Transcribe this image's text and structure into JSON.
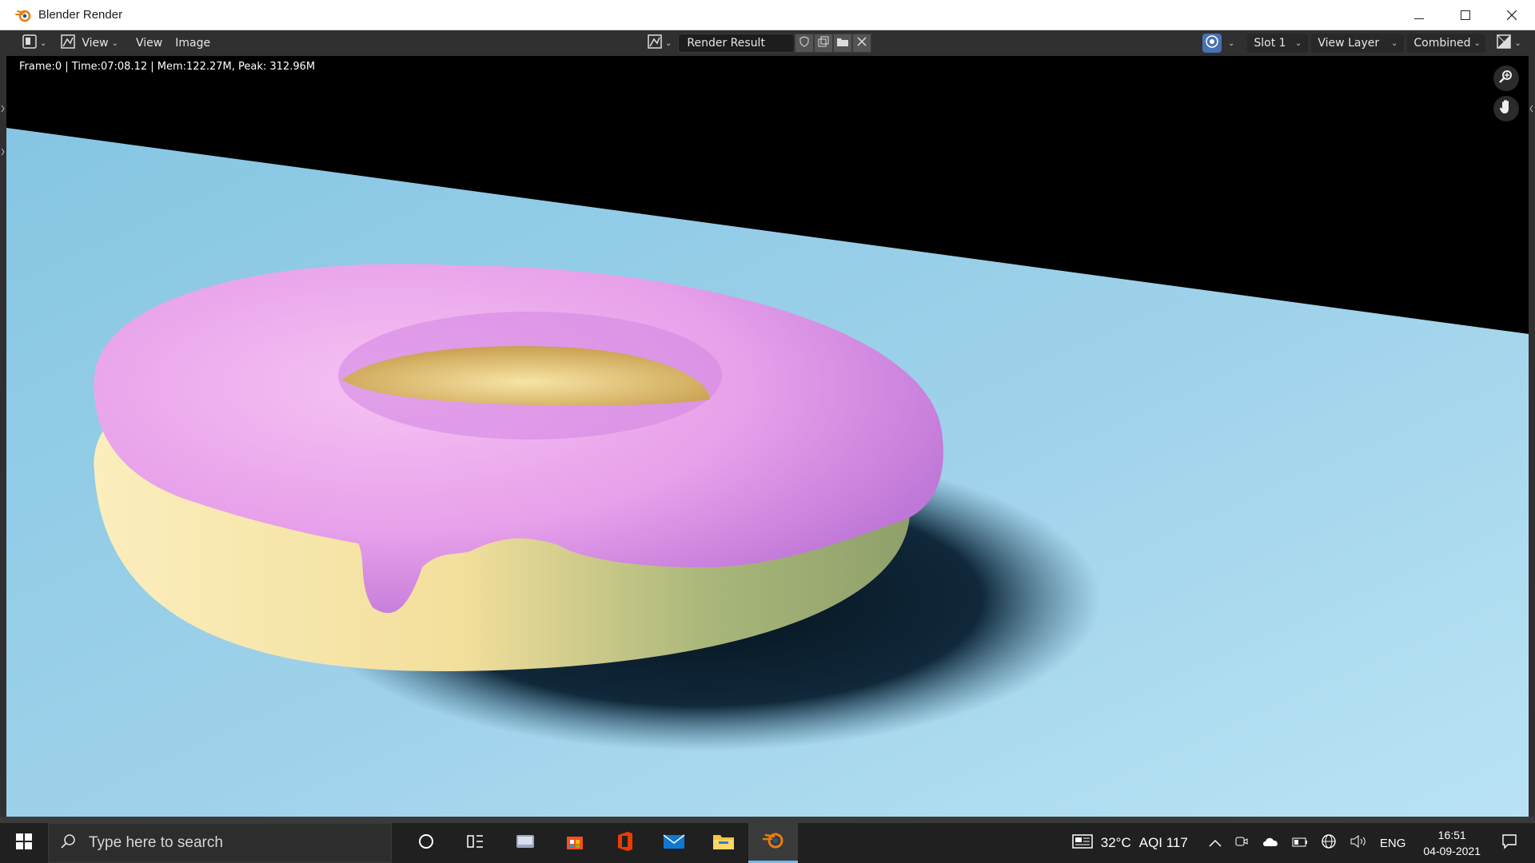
{
  "window": {
    "title": "Blender Render"
  },
  "header": {
    "view_menu_1": "View",
    "view_menu_2": "View",
    "image_menu": "Image",
    "image_name": "Render Result",
    "slot": "Slot 1",
    "view_layer": "View Layer",
    "pass": "Combined"
  },
  "viewport": {
    "stats": "Frame:0 | Time:07:08.12 | Mem:122.27M, Peak: 312.96M"
  },
  "taskbar": {
    "search_placeholder": "Type here to search",
    "weather": "32°C",
    "aqi": "AQI 117",
    "language": "ENG",
    "time": "16:51",
    "date": "04-09-2021"
  },
  "colors": {
    "accent": "#4772b3",
    "icing": "#e9a2ec",
    "dough": "#f5e6a8",
    "floor": "#9fd3ea"
  }
}
